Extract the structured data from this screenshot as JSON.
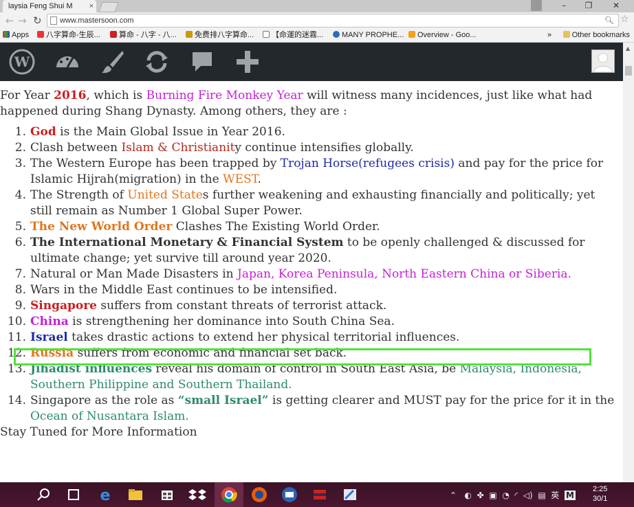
{
  "browser": {
    "tab_title": "laysia Feng Shui M",
    "tab_close": "×",
    "url": "www.mastersoon.com",
    "bookmarks": [
      "Apps",
      "八字算命-生辰...",
      "算命 - 八字 - 八...",
      "免费排八字算命...",
      "【命運的迷霧...",
      "MANY PROPHE...",
      "Overview - Goo..."
    ],
    "bookmarks_more": "»",
    "other_bookmarks": "Other bookmarks"
  },
  "wp_admin_bar": {
    "icons": [
      "wordpress-logo-icon",
      "dashboard-icon",
      "customize-brush-icon",
      "updates-icon",
      "comments-icon",
      "new-content-plus-icon",
      "user-avatar-icon"
    ]
  },
  "article": {
    "intro": [
      {
        "text": "For Year ",
        "style": ""
      },
      {
        "text": "2016",
        "style": "b red"
      },
      {
        "text": ", which is ",
        "style": ""
      },
      {
        "text": "Burning Fire Monkey Year",
        "style": "magenta"
      },
      {
        "text": " will witness many incidences, just like what had happened during Shang Dynasty. Among others, they are :",
        "style": ""
      }
    ],
    "items": [
      {
        "num": "1.",
        "parts": [
          {
            "text": "God",
            "style": "b red"
          },
          {
            "text": " is the Main Global Issue in Year 2016.",
            "style": ""
          }
        ]
      },
      {
        "num": "2.",
        "parts": [
          {
            "text": "Clash between ",
            "style": ""
          },
          {
            "text": "Islam & Christianit",
            "style": "darkred"
          },
          {
            "text": "y continue intensifies globally.",
            "style": ""
          }
        ]
      },
      {
        "num": "3.",
        "parts": [
          {
            "text": "The Western Europe has been trapped by ",
            "style": ""
          },
          {
            "text": "Trojan Horse(refugees crisis)",
            "style": "navy"
          },
          {
            "text": " and pay for the price for Islamic Hijrah(migration) in the ",
            "style": ""
          },
          {
            "text": "WEST",
            "style": "orange"
          },
          {
            "text": ".",
            "style": ""
          }
        ]
      },
      {
        "num": "4.",
        "parts": [
          {
            "text": "The Strength of ",
            "style": ""
          },
          {
            "text": "United State",
            "style": "orange"
          },
          {
            "text": "s further weakening and exhausting financially and politically; yet still remain as Number 1 Global Super Power.",
            "style": ""
          }
        ]
      },
      {
        "num": "5.",
        "parts": [
          {
            "text": "The New World Order",
            "style": "b orange"
          },
          {
            "text": " Clashes The Existing World Order.",
            "style": ""
          }
        ]
      },
      {
        "num": "6.",
        "parts": [
          {
            "text": "The International Monetary & Financial System",
            "style": "b"
          },
          {
            "text": " to be openly challenged & discussed for ultimate change; yet survive till around year 2020.",
            "style": ""
          }
        ]
      },
      {
        "num": "7.",
        "parts": [
          {
            "text": "Natural or Man Made Disasters in ",
            "style": ""
          },
          {
            "text": "Japan, Korea Peninsula, North Eastern China or Siberia.",
            "style": "magenta"
          }
        ]
      },
      {
        "num": "8.",
        "parts": [
          {
            "text": "Wars in the Middle East continues to be intensified.",
            "style": ""
          }
        ]
      },
      {
        "num": "9.",
        "parts": [
          {
            "text": "Singapore",
            "style": "b red"
          },
          {
            "text": " suffers from constant threats of terrorist attack.",
            "style": ""
          }
        ]
      },
      {
        "num": "10.",
        "parts": [
          {
            "text": "China",
            "style": "b magenta"
          },
          {
            "text": " is strengthening her dominance into South China Sea.",
            "style": ""
          }
        ]
      },
      {
        "num": "11.",
        "parts": [
          {
            "text": "Israel",
            "style": "b navy"
          },
          {
            "text": " takes drastic actions to extend her physical territorial influences.",
            "style": ""
          }
        ]
      },
      {
        "num": "12.",
        "parts": [
          {
            "text": "Russia",
            "style": "b orange"
          },
          {
            "text": " suffers from economic and financial set back.",
            "style": ""
          }
        ]
      },
      {
        "num": "13.",
        "parts": [
          {
            "text": "Jihadist influences",
            "style": "b teal"
          },
          {
            "text": " reveal his domain of control in South East Asia, be ",
            "style": ""
          },
          {
            "text": "Malaysia, Indonesia, Southern Philippine and Southern Thailand.",
            "style": "teal"
          }
        ]
      },
      {
        "num": "14.",
        "parts": [
          {
            "text": "Singapore as the role as ",
            "style": ""
          },
          {
            "text": "“small Israel”",
            "style": "b teal"
          },
          {
            "text": " is getting clearer and MUST pay for the price for it in the ",
            "style": ""
          },
          {
            "text": "Ocean of Nusantara Islam.",
            "style": "teal"
          }
        ]
      }
    ],
    "outro": "Stay Tuned for More Information"
  },
  "colors": {
    "red": "#cc1d1d",
    "magenta": "#c421d6",
    "navy": "#1f2aa6",
    "orange": "#e0761c",
    "teal": "#2d8a70",
    "highlight": "#54e03a",
    "wpbar": "#23282d"
  },
  "taskbar": {
    "apps": [
      "search-icon",
      "task-view-icon",
      "edge-icon",
      "file-explorer-icon",
      "store-icon",
      "dropbox-icon",
      "chrome-icon",
      "firefox-icon",
      "thunderbird-icon",
      "app-icon",
      "paint-icon"
    ],
    "tray_text": "英",
    "clock_time": "2:25",
    "clock_date": "30/1"
  }
}
